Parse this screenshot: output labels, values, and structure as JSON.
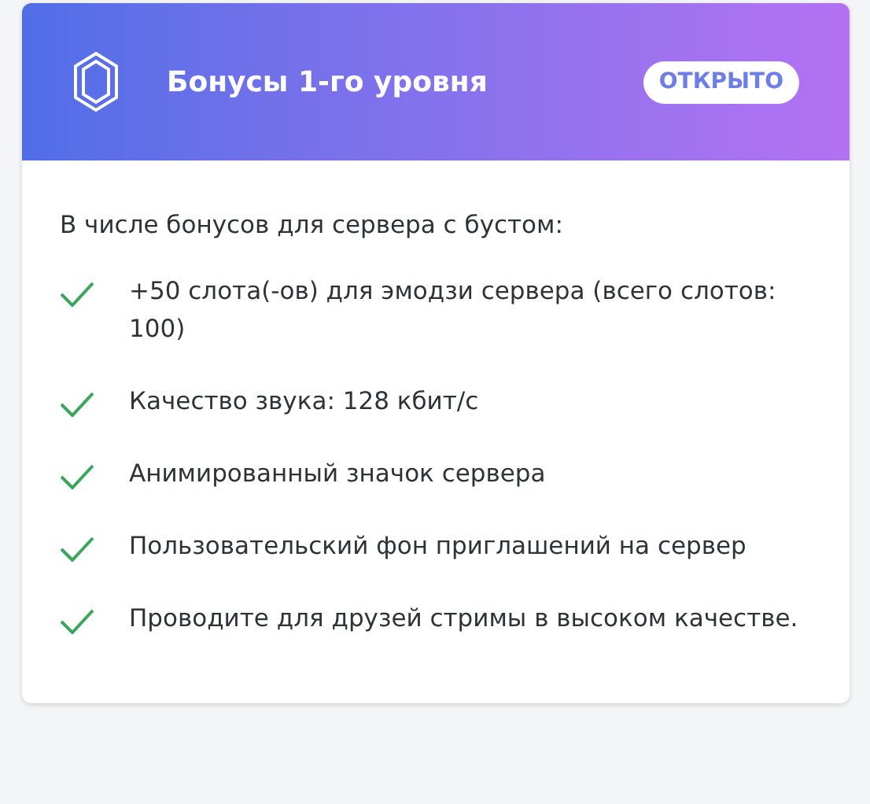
{
  "header": {
    "title": "Бонусы 1-го уровня",
    "badge": "ОТКРЫТО"
  },
  "intro": "В числе бонусов для сервера с бустом:",
  "perks": [
    {
      "text": "+50 слота(-ов) для эмодзи сервера (всего слотов: 100)"
    },
    {
      "text": "Качество звука: 128 кбит/с"
    },
    {
      "text": "Анимированный значок сервера"
    },
    {
      "text": "Пользовательский фон приглашений на сервер"
    },
    {
      "text": "Проводите для друзей стримы в высоком качестве."
    }
  ]
}
